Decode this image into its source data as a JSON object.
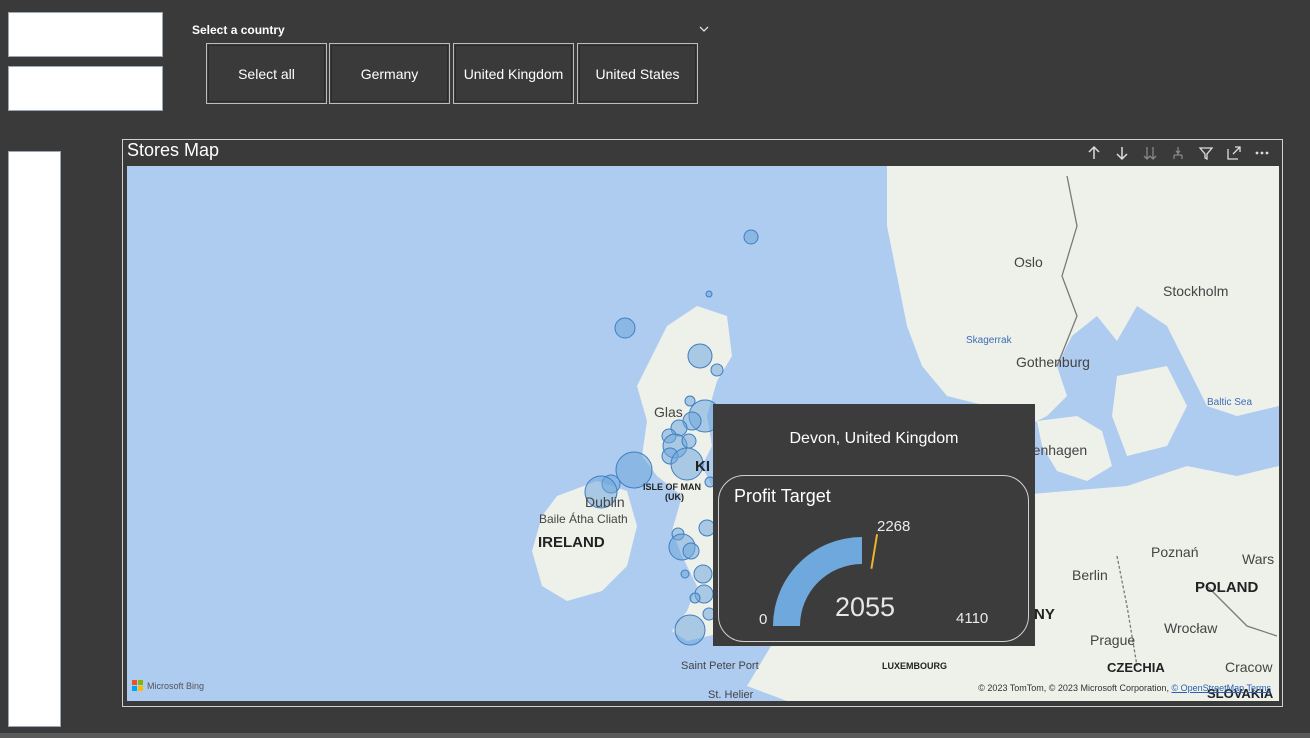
{
  "slicer": {
    "title": "Select a country",
    "options": [
      "Select all",
      "Germany",
      "United Kingdom",
      "United States"
    ]
  },
  "visual": {
    "title": "Stores Map",
    "header_icons": [
      "arrow-up-icon",
      "arrow-down-icon",
      "double-arrow-down-icon",
      "expand-hierarchy-icon",
      "filter-icon",
      "focus-mode-icon",
      "more-options-icon"
    ]
  },
  "map": {
    "labels": {
      "oslo": "Oslo",
      "stockholm": "Stockholm",
      "skagerrak": "Skagerrak",
      "gothenburg": "Gothenburg",
      "baltic_sea": "Baltic Sea",
      "copenhagen": "Copenhagen",
      "dublin": "Dublin",
      "baile": "Baile Átha Cliath",
      "ireland": "IRELAND",
      "isle_of_man": "ISLE OF MAN",
      "uk_short": "(UK)",
      "berlin": "Berlin",
      "poznan": "Poznań",
      "warsaw": "Wars",
      "poland": "POLAND",
      "prague": "Prague",
      "wroclaw": "Wrocław",
      "czechia": "CZECHIA",
      "cracow": "Cracow",
      "slovakia": "SLOVAKIA",
      "luxembourg": "LUXEMBOURG",
      "saint_peter_port": "Saint Peter Port",
      "st_helier": "St. Helier",
      "germany_partial": "NY",
      "glasgow_partial": "Glas",
      "uk_partial": "KI"
    },
    "bing_logo": "Microsoft Bing",
    "copyright": "© 2023 TomTom, © 2023 Microsoft Corporation, ",
    "osm_link": "© OpenStreetMap",
    "terms_link": "Terms"
  },
  "tooltip": {
    "title": "Devon, United Kingdom",
    "gauge": {
      "title": "Profit Target",
      "min": "0",
      "max": "4110",
      "target": "2268",
      "value": "2055",
      "value_num": 2055,
      "min_num": 0,
      "max_num": 4110,
      "target_num": 2268
    }
  },
  "colors": {
    "background": "#3a3a3a",
    "sea": "#aecbf0",
    "land": "#f2efe9",
    "bubble": "#6fa8dc",
    "gauge_fill": "#6fa8dc",
    "target_marker": "#f0b429"
  }
}
